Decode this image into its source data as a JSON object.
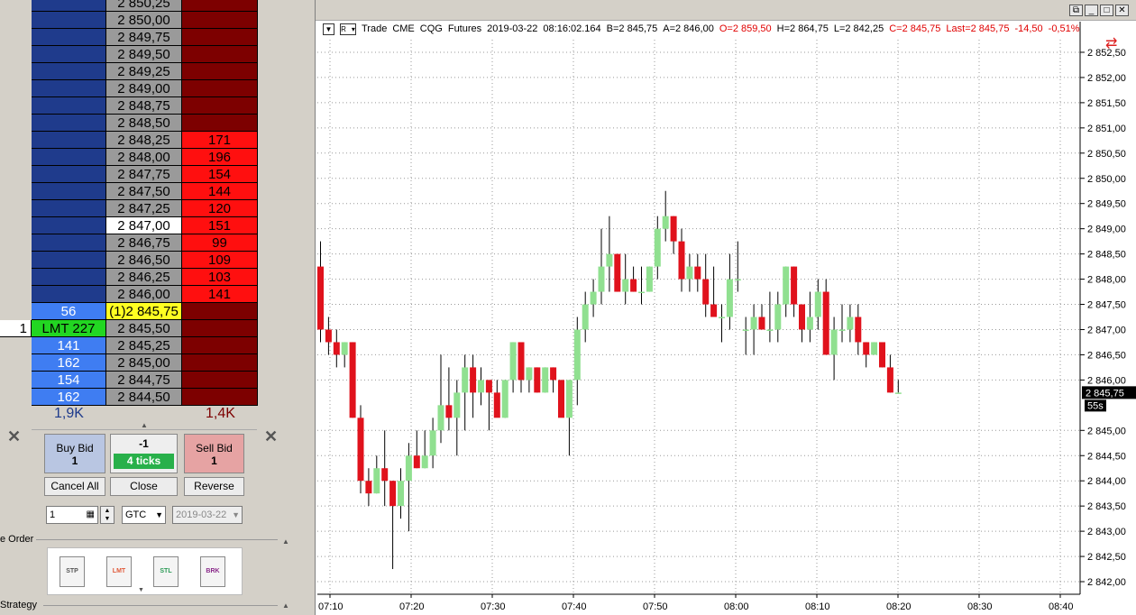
{
  "ladder": {
    "rows": [
      {
        "qty": "",
        "bid": "",
        "price": "2 850,25",
        "ask": "",
        "ask_style": "dark",
        "price_style": "gray",
        "bid_style": "dark"
      },
      {
        "qty": "",
        "bid": "",
        "price": "2 850,00",
        "ask": "",
        "ask_style": "dark",
        "price_style": "gray",
        "bid_style": "dark"
      },
      {
        "qty": "",
        "bid": "",
        "price": "2 849,75",
        "ask": "",
        "ask_style": "dark",
        "price_style": "gray",
        "bid_style": "dark"
      },
      {
        "qty": "",
        "bid": "",
        "price": "2 849,50",
        "ask": "",
        "ask_style": "dark",
        "price_style": "gray",
        "bid_style": "dark"
      },
      {
        "qty": "",
        "bid": "",
        "price": "2 849,25",
        "ask": "",
        "ask_style": "dark",
        "price_style": "gray",
        "bid_style": "dark"
      },
      {
        "qty": "",
        "bid": "",
        "price": "2 849,00",
        "ask": "",
        "ask_style": "dark",
        "price_style": "gray",
        "bid_style": "dark"
      },
      {
        "qty": "",
        "bid": "",
        "price": "2 848,75",
        "ask": "",
        "ask_style": "dark",
        "price_style": "gray",
        "bid_style": "dark"
      },
      {
        "qty": "",
        "bid": "",
        "price": "2 848,50",
        "ask": "",
        "ask_style": "dark",
        "price_style": "gray",
        "bid_style": "dark"
      },
      {
        "qty": "",
        "bid": "",
        "price": "2 848,25",
        "ask": "171",
        "ask_style": "red",
        "price_style": "gray",
        "bid_style": "dark"
      },
      {
        "qty": "",
        "bid": "",
        "price": "2 848,00",
        "ask": "196",
        "ask_style": "red",
        "price_style": "gray",
        "bid_style": "dark"
      },
      {
        "qty": "",
        "bid": "",
        "price": "2 847,75",
        "ask": "154",
        "ask_style": "red",
        "price_style": "gray",
        "bid_style": "dark"
      },
      {
        "qty": "",
        "bid": "",
        "price": "2 847,50",
        "ask": "144",
        "ask_style": "red",
        "price_style": "gray",
        "bid_style": "dark"
      },
      {
        "qty": "",
        "bid": "",
        "price": "2 847,25",
        "ask": "120",
        "ask_style": "red",
        "price_style": "gray",
        "bid_style": "dark"
      },
      {
        "qty": "",
        "bid": "",
        "price": "2 847,00",
        "ask": "151",
        "ask_style": "red",
        "price_style": "cur",
        "bid_style": "dark"
      },
      {
        "qty": "",
        "bid": "",
        "price": "2 846,75",
        "ask": "99",
        "ask_style": "red",
        "price_style": "gray",
        "bid_style": "dark"
      },
      {
        "qty": "",
        "bid": "",
        "price": "2 846,50",
        "ask": "109",
        "ask_style": "red",
        "price_style": "gray",
        "bid_style": "dark"
      },
      {
        "qty": "",
        "bid": "",
        "price": "2 846,25",
        "ask": "103",
        "ask_style": "red",
        "price_style": "gray",
        "bid_style": "dark"
      },
      {
        "qty": "",
        "bid": "",
        "price": "2 846,00",
        "ask": "141",
        "ask_style": "red",
        "price_style": "gray",
        "bid_style": "dark"
      },
      {
        "qty": "",
        "bid": "56",
        "price": "(1)2 845,75",
        "ask": "",
        "ask_style": "dark",
        "price_style": "yel",
        "bid_style": "lb"
      },
      {
        "qty": "1",
        "bid": "LMT 227",
        "price": "2 845,50",
        "ask": "",
        "ask_style": "dark",
        "price_style": "gray",
        "bid_style": "lmt"
      },
      {
        "qty": "",
        "bid": "141",
        "price": "2 845,25",
        "ask": "",
        "ask_style": "dark",
        "price_style": "gray",
        "bid_style": "lb"
      },
      {
        "qty": "",
        "bid": "162",
        "price": "2 845,00",
        "ask": "",
        "ask_style": "dark",
        "price_style": "gray",
        "bid_style": "lb"
      },
      {
        "qty": "",
        "bid": "154",
        "price": "2 844,75",
        "ask": "",
        "ask_style": "dark",
        "price_style": "gray",
        "bid_style": "lb"
      },
      {
        "qty": "",
        "bid": "162",
        "price": "2 844,50",
        "ask": "",
        "ask_style": "dark",
        "price_style": "gray",
        "bid_style": "lb"
      }
    ],
    "bid_total": "1,9K",
    "ask_total": "1,4K"
  },
  "order_panel": {
    "buy_label": "Buy Bid",
    "buy_qty": "1",
    "position": "-1",
    "ticks": "4 ticks",
    "sell_label": "Sell Bid",
    "sell_qty": "1",
    "cancel_all": "Cancel All",
    "close": "Close",
    "reverse": "Reverse",
    "quantity_value": "1",
    "tif_value": "GTC",
    "date_value": "2019-03-22",
    "section_order": "e Order",
    "section_strategy": "Strategy",
    "tools": [
      {
        "label": "STP",
        "color": "#555555",
        "icon": "stop-order-icon"
      },
      {
        "label": "LMT",
        "color": "#e05a3a",
        "icon": "limit-order-icon"
      },
      {
        "label": "STL",
        "color": "#2a9a55",
        "icon": "stop-limit-order-icon"
      },
      {
        "label": "BRK",
        "color": "#8a2a8a",
        "icon": "bracket-order-icon"
      }
    ]
  },
  "chart_header": {
    "mode": "Trade",
    "exchange": "CME",
    "feed": "CQG",
    "instrument": "Futures",
    "date": "2019-03-22",
    "time": "08:16:02.164",
    "bid": "B=2 845,75",
    "ask": "A=2 846,00",
    "open": "O=2 859,50",
    "high": "H=2 864,75",
    "low": "L=2 842,25",
    "close": "C=2 845,75",
    "last": "Last=2 845,75",
    "change": "-14,50",
    "change_pct": "-0,51%",
    "r_button": "R"
  },
  "chart_data": {
    "type": "candlestick",
    "y_ticks": [
      "2 852,50",
      "2 852,00",
      "2 851,50",
      "2 851,00",
      "2 850,50",
      "2 850,00",
      "2 849,50",
      "2 849,00",
      "2 848,50",
      "2 848,00",
      "2 847,50",
      "2 847,00",
      "2 846,50",
      "2 846,00",
      "2 845,00",
      "2 844,50",
      "2 844,00",
      "2 843,50",
      "2 843,00",
      "2 842,50",
      "2 842,00"
    ],
    "x_ticks": [
      "07:10",
      "07:20",
      "07:30",
      "07:40",
      "07:50",
      "08:00",
      "08:10",
      "08:20",
      "08:30",
      "08:40"
    ],
    "last_price_label": "2 845,75",
    "countdown_label": "55s",
    "ylim": [
      2841.75,
      2852.75
    ],
    "grid": true,
    "candles": [
      {
        "o": 2848.25,
        "h": 2848.75,
        "l": 2846.75,
        "c": 2847.0
      },
      {
        "o": 2847.0,
        "h": 2847.25,
        "l": 2846.5,
        "c": 2846.75
      },
      {
        "o": 2846.75,
        "h": 2847.0,
        "l": 2846.25,
        "c": 2846.5
      },
      {
        "o": 2846.5,
        "h": 2846.75,
        "l": 2846.25,
        "c": 2846.75
      },
      {
        "o": 2846.75,
        "h": 2846.75,
        "l": 2845.25,
        "c": 2845.25
      },
      {
        "o": 2845.25,
        "h": 2845.5,
        "l": 2843.75,
        "c": 2844.0
      },
      {
        "o": 2844.0,
        "h": 2844.25,
        "l": 2843.5,
        "c": 2843.75
      },
      {
        "o": 2843.75,
        "h": 2844.5,
        "l": 2843.75,
        "c": 2844.25
      },
      {
        "o": 2844.25,
        "h": 2845.0,
        "l": 2843.5,
        "c": 2844.0
      },
      {
        "o": 2844.0,
        "h": 2844.0,
        "l": 2842.25,
        "c": 2843.5
      },
      {
        "o": 2843.5,
        "h": 2844.25,
        "l": 2843.25,
        "c": 2844.0
      },
      {
        "o": 2844.0,
        "h": 2844.75,
        "l": 2843.0,
        "c": 2844.5
      },
      {
        "o": 2844.5,
        "h": 2845.0,
        "l": 2844.25,
        "c": 2844.25
      },
      {
        "o": 2844.25,
        "h": 2845.0,
        "l": 2844.25,
        "c": 2844.5
      },
      {
        "o": 2844.5,
        "h": 2845.25,
        "l": 2844.25,
        "c": 2845.0
      },
      {
        "o": 2845.0,
        "h": 2846.5,
        "l": 2844.75,
        "c": 2845.5
      },
      {
        "o": 2845.5,
        "h": 2846.25,
        "l": 2845.0,
        "c": 2845.25
      },
      {
        "o": 2845.25,
        "h": 2846.0,
        "l": 2844.5,
        "c": 2845.75
      },
      {
        "o": 2845.75,
        "h": 2846.5,
        "l": 2845.0,
        "c": 2846.25
      },
      {
        "o": 2846.25,
        "h": 2846.5,
        "l": 2845.25,
        "c": 2845.75
      },
      {
        "o": 2845.75,
        "h": 2846.25,
        "l": 2845.5,
        "c": 2846.0
      },
      {
        "o": 2846.0,
        "h": 2846.0,
        "l": 2845.0,
        "c": 2845.75
      },
      {
        "o": 2845.75,
        "h": 2846.0,
        "l": 2845.5,
        "c": 2845.25
      },
      {
        "o": 2845.25,
        "h": 2846.0,
        "l": 2845.25,
        "c": 2846.0
      },
      {
        "o": 2846.0,
        "h": 2846.75,
        "l": 2845.75,
        "c": 2846.75
      },
      {
        "o": 2846.75,
        "h": 2846.75,
        "l": 2845.75,
        "c": 2846.0
      },
      {
        "o": 2846.0,
        "h": 2846.25,
        "l": 2845.75,
        "c": 2846.25
      },
      {
        "o": 2846.25,
        "h": 2846.25,
        "l": 2845.75,
        "c": 2845.75
      },
      {
        "o": 2845.75,
        "h": 2846.25,
        "l": 2845.75,
        "c": 2846.25
      },
      {
        "o": 2846.25,
        "h": 2846.25,
        "l": 2845.75,
        "c": 2846.0
      },
      {
        "o": 2846.0,
        "h": 2846.0,
        "l": 2845.75,
        "c": 2845.25
      },
      {
        "o": 2845.25,
        "h": 2846.0,
        "l": 2844.5,
        "c": 2846.0
      },
      {
        "o": 2846.0,
        "h": 2847.25,
        "l": 2845.5,
        "c": 2847.0
      },
      {
        "o": 2847.0,
        "h": 2847.75,
        "l": 2846.75,
        "c": 2847.5
      },
      {
        "o": 2847.5,
        "h": 2848.0,
        "l": 2847.25,
        "c": 2847.75
      },
      {
        "o": 2847.75,
        "h": 2849.0,
        "l": 2847.5,
        "c": 2848.25
      },
      {
        "o": 2848.25,
        "h": 2849.25,
        "l": 2847.75,
        "c": 2848.5
      },
      {
        "o": 2848.5,
        "h": 2848.5,
        "l": 2847.75,
        "c": 2847.75
      },
      {
        "o": 2847.75,
        "h": 2848.5,
        "l": 2847.5,
        "c": 2848.0
      },
      {
        "o": 2848.0,
        "h": 2848.25,
        "l": 2847.75,
        "c": 2847.75
      },
      {
        "o": 2847.75,
        "h": 2848.25,
        "l": 2847.5,
        "c": 2847.75
      },
      {
        "o": 2847.75,
        "h": 2848.25,
        "l": 2847.75,
        "c": 2848.25
      },
      {
        "o": 2848.25,
        "h": 2849.25,
        "l": 2848.0,
        "c": 2849.0
      },
      {
        "o": 2849.0,
        "h": 2849.75,
        "l": 2848.75,
        "c": 2849.25
      },
      {
        "o": 2849.25,
        "h": 2849.25,
        "l": 2848.5,
        "c": 2848.75
      },
      {
        "o": 2848.75,
        "h": 2849.0,
        "l": 2847.75,
        "c": 2848.0
      },
      {
        "o": 2848.0,
        "h": 2848.5,
        "l": 2847.75,
        "c": 2848.25
      },
      {
        "o": 2848.25,
        "h": 2848.5,
        "l": 2847.75,
        "c": 2848.0
      },
      {
        "o": 2848.0,
        "h": 2848.5,
        "l": 2847.25,
        "c": 2847.5
      },
      {
        "o": 2847.5,
        "h": 2848.25,
        "l": 2847.25,
        "c": 2847.25
      },
      {
        "o": 2847.25,
        "h": 2847.5,
        "l": 2846.75,
        "c": 2847.25
      },
      {
        "o": 2847.25,
        "h": 2848.5,
        "l": 2847.0,
        "c": 2848.0
      },
      {
        "o": 2848.0,
        "h": 2848.75,
        "l": 2847.75,
        "c": 2848.0
      },
      {
        "o": 2847.0,
        "h": 2847.25,
        "l": 2846.5,
        "c": 2847.0
      },
      {
        "o": 2847.0,
        "h": 2847.5,
        "l": 2846.5,
        "c": 2847.25
      },
      {
        "o": 2847.25,
        "h": 2847.5,
        "l": 2847.0,
        "c": 2847.0
      },
      {
        "o": 2847.0,
        "h": 2847.75,
        "l": 2846.75,
        "c": 2847.0
      },
      {
        "o": 2847.0,
        "h": 2847.75,
        "l": 2846.75,
        "c": 2847.5
      },
      {
        "o": 2847.5,
        "h": 2848.25,
        "l": 2847.25,
        "c": 2848.25
      },
      {
        "o": 2848.25,
        "h": 2848.25,
        "l": 2847.25,
        "c": 2847.5
      },
      {
        "o": 2847.5,
        "h": 2847.5,
        "l": 2846.75,
        "c": 2847.0
      },
      {
        "o": 2847.0,
        "h": 2847.75,
        "l": 2846.75,
        "c": 2847.25
      },
      {
        "o": 2847.25,
        "h": 2848.0,
        "l": 2847.0,
        "c": 2847.75
      },
      {
        "o": 2847.75,
        "h": 2848.0,
        "l": 2846.5,
        "c": 2846.5
      },
      {
        "o": 2846.5,
        "h": 2847.25,
        "l": 2846.0,
        "c": 2847.0
      },
      {
        "o": 2847.0,
        "h": 2847.5,
        "l": 2846.75,
        "c": 2847.0
      },
      {
        "o": 2847.0,
        "h": 2847.5,
        "l": 2846.75,
        "c": 2847.25
      },
      {
        "o": 2847.25,
        "h": 2847.5,
        "l": 2846.5,
        "c": 2846.75
      },
      {
        "o": 2846.75,
        "h": 2846.75,
        "l": 2846.25,
        "c": 2846.5
      },
      {
        "o": 2846.5,
        "h": 2846.75,
        "l": 2846.5,
        "c": 2846.75
      },
      {
        "o": 2846.75,
        "h": 2846.75,
        "l": 2846.25,
        "c": 2846.25
      },
      {
        "o": 2846.25,
        "h": 2846.5,
        "l": 2845.75,
        "c": 2845.75
      },
      {
        "o": 2845.75,
        "h": 2846.0,
        "l": 2845.75,
        "c": 2845.75
      }
    ]
  }
}
